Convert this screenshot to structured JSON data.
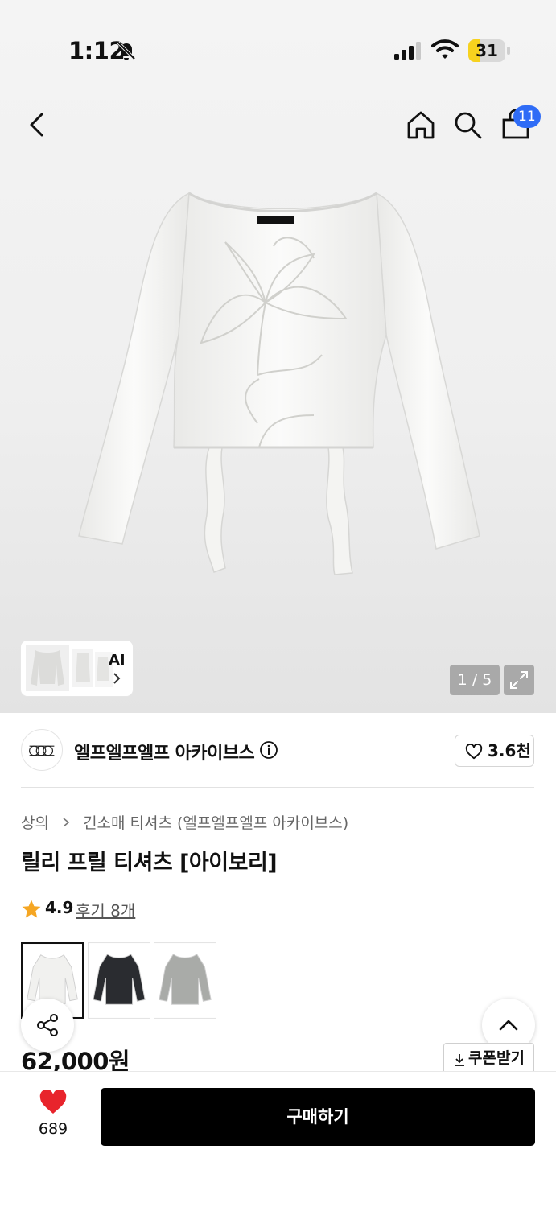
{
  "status_bar": {
    "time": "1:12",
    "battery": "31",
    "battery_level": 0.31
  },
  "nav": {
    "cart_count": "11"
  },
  "gallery": {
    "ai_label": "AI",
    "counter": "1 / 5"
  },
  "brand": {
    "name": "엘프엘프엘프 아카이브스",
    "likes": "3.6천"
  },
  "breadcrumb": {
    "category": "상의",
    "subcategory": "긴소매 티셔츠 (엘프엘프엘프 아카이브스)"
  },
  "product": {
    "title": "릴리 프릴 티셔츠 [아이보리]",
    "rating": "4.9",
    "reviews": "후기 8개",
    "price": "62,000원",
    "coupon_label": "쿠폰받기",
    "colors": [
      {
        "name": "ivory",
        "hex": "#f1f1ef"
      },
      {
        "name": "black",
        "hex": "#2a2c30"
      },
      {
        "name": "gray",
        "hex": "#a9aba8"
      }
    ]
  },
  "bottom_bar": {
    "wish_count": "689",
    "buy_label": "구매하기"
  },
  "colors": {
    "accent_blue": "#2f6cf6",
    "star": "#f5a623",
    "heart": "#e8242c",
    "button_black": "#000000"
  }
}
